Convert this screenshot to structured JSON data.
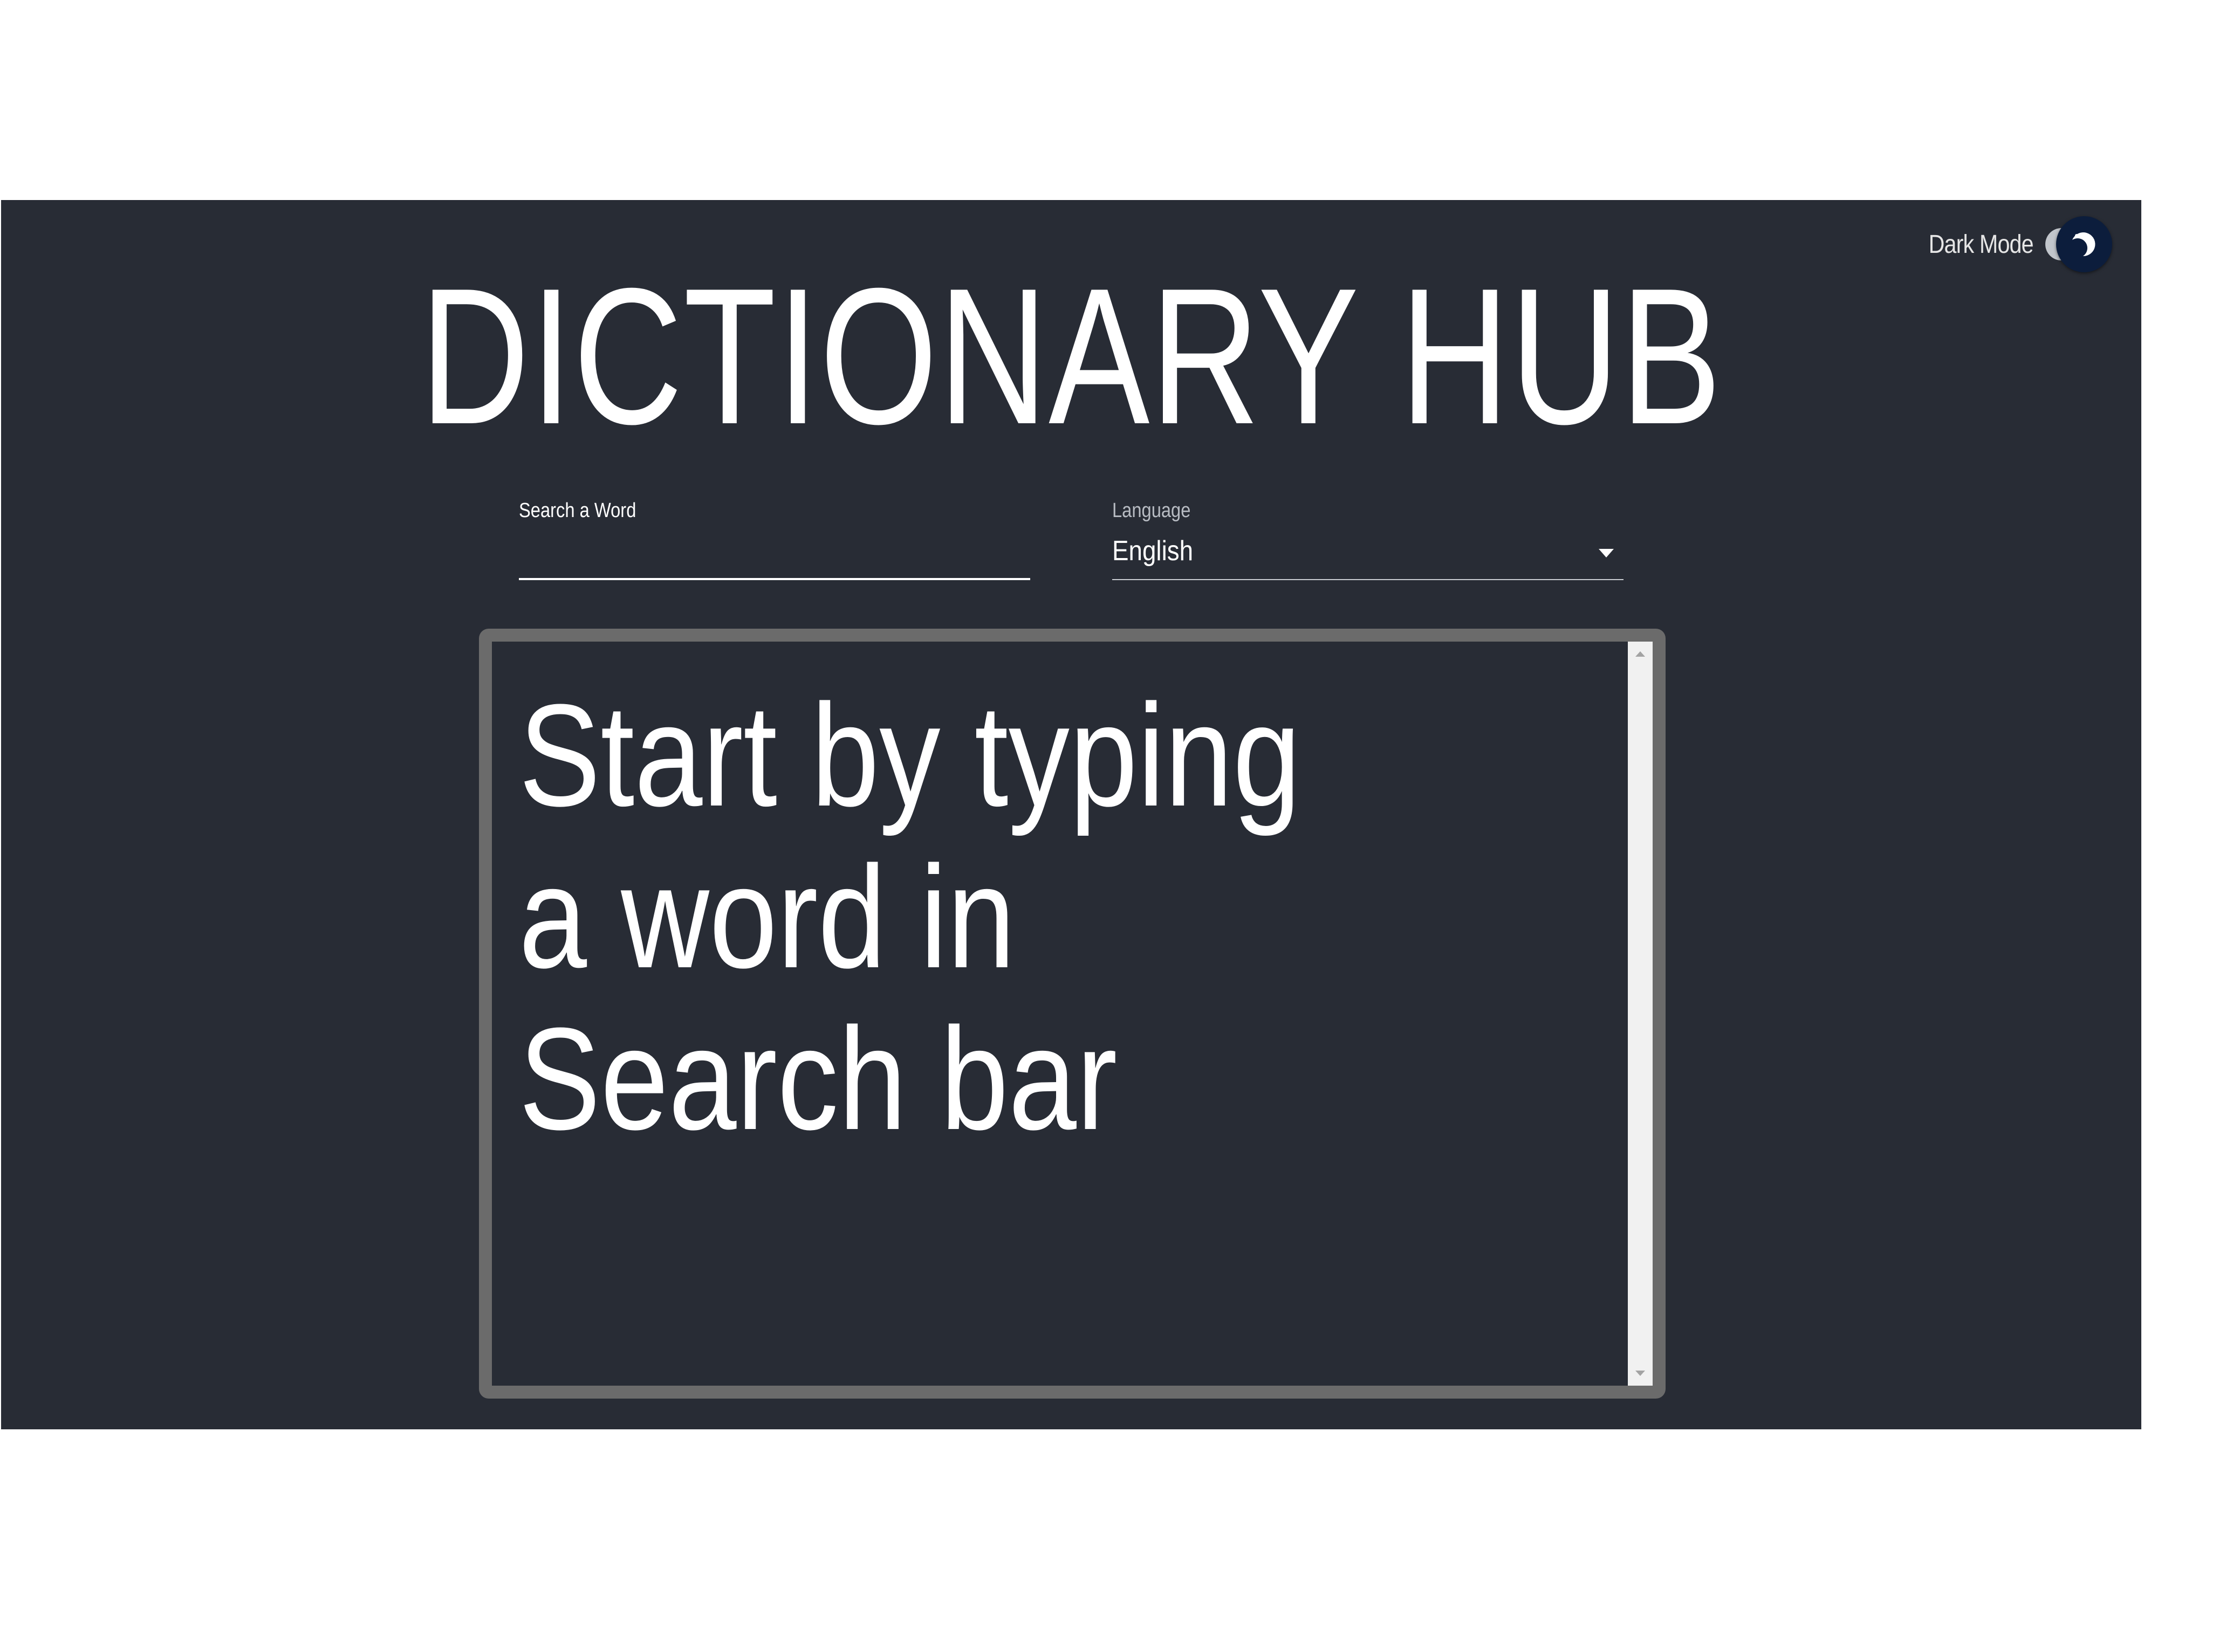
{
  "header": {
    "dark_mode_label": "Dark Mode",
    "dark_mode_enabled": true,
    "title": "DICTIONARY HUB"
  },
  "search": {
    "label": "Search a Word",
    "value": "",
    "placeholder": ""
  },
  "language": {
    "label": "Language",
    "selected": "English"
  },
  "result": {
    "message": "Start by typing a word in Search bar"
  },
  "colors": {
    "background": "#282c35",
    "text": "#ffffff",
    "result_border": "#6b6b6b",
    "toggle_knob": "#0c1d3c"
  },
  "icons": {
    "toggle_knob_icon": "moon-icon",
    "dropdown_icon": "caret-down-icon"
  }
}
